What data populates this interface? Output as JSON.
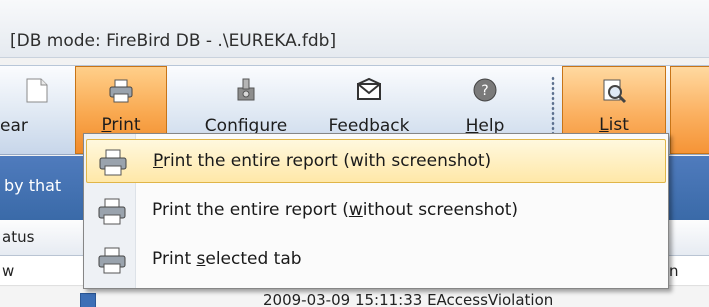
{
  "window": {
    "title": "[DB mode: FireBird DB - .\\EUREKA.fdb]"
  },
  "toolbar": {
    "buttons": [
      {
        "label": "ear",
        "icon": "clear-icon"
      },
      {
        "label": "Print",
        "icon": "printer-icon",
        "active": true
      },
      {
        "label": "Configure",
        "icon": "configure-icon"
      },
      {
        "label": "Feedback",
        "icon": "feedback-envelope-icon"
      },
      {
        "label": "Help",
        "icon": "help-icon"
      },
      {
        "label": "List",
        "icon": "list-search-icon",
        "active": true
      }
    ]
  },
  "background": {
    "band_text": "by that",
    "header_text": "atus",
    "row1_text": "w",
    "row1_right_text": "n",
    "row2_text": "2009-03-09 15:11:33     EAccessViolation"
  },
  "print_menu": {
    "items": [
      {
        "label": "Print the entire report (with screenshot)",
        "icon": "printer-icon",
        "selected": true
      },
      {
        "label": "Print the entire report (without screenshot)",
        "icon": "printer-icon",
        "selected": false
      },
      {
        "label": "Print selected tab",
        "icon": "printer-icon",
        "selected": false
      }
    ]
  },
  "colors": {
    "accent_orange": "#f9a84f",
    "menu_highlight": "#ffe8a8",
    "toolbar_blue": "#dfe8f3",
    "band_blue": "#3a6aa8"
  }
}
